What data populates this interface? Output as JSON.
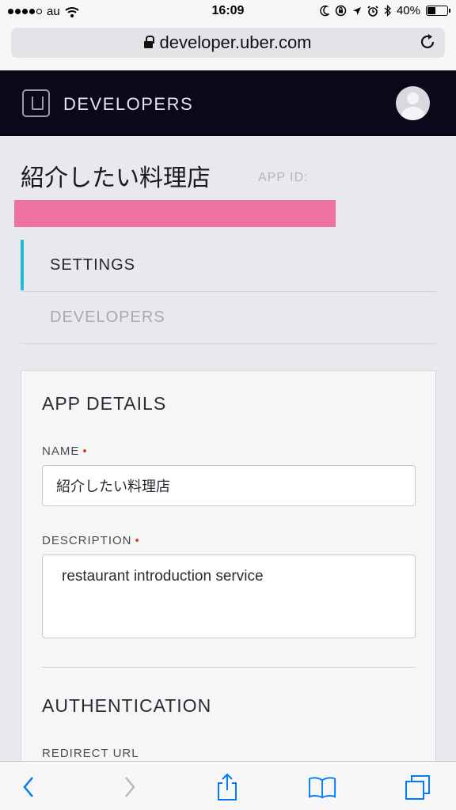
{
  "status_bar": {
    "carrier": "au",
    "time": "16:09",
    "battery_percent": "40%",
    "battery_level": 0.4,
    "icons": [
      "signal-dots-icon",
      "wifi-icon",
      "moon-icon",
      "rotation-lock-icon",
      "location-arrow-icon",
      "alarm-icon",
      "bluetooth-icon",
      "battery-icon"
    ]
  },
  "browser": {
    "url": "developer.uber.com",
    "icons": [
      "lock-icon",
      "reload-icon"
    ]
  },
  "header": {
    "brand": "DEVELOPERS",
    "icons": [
      "uber-logo-icon",
      "user-avatar-icon"
    ],
    "background": "#09091a"
  },
  "app": {
    "title": "紹介したい料理店",
    "app_id_label": "APP ID:",
    "app_id_redaction_color": "#ee73a3"
  },
  "nav": {
    "items": [
      {
        "label": "SETTINGS",
        "active": true
      },
      {
        "label": "DEVELOPERS",
        "active": false
      }
    ],
    "active_color": "#1fbad6"
  },
  "card": {
    "heading": "APP DETAILS",
    "name_label": "NAME",
    "name_value": "紹介したい料理店",
    "description_label": "DESCRIPTION",
    "description_value": "restaurant introduction service",
    "required_marker": "•",
    "auth_heading": "AUTHENTICATION",
    "redirect_label": "REDIRECT URL"
  },
  "toolbar": {
    "icons": [
      "back-icon",
      "forward-icon",
      "share-icon",
      "bookmarks-icon",
      "tabs-icon"
    ],
    "accent": "#007aff"
  }
}
